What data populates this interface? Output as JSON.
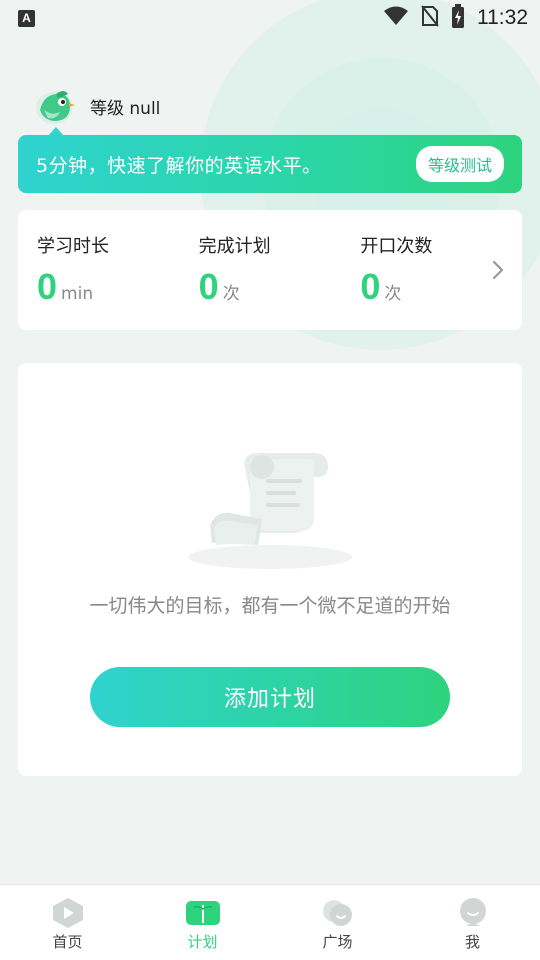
{
  "status_bar": {
    "left_icon": "A",
    "time": "11:32",
    "icons": [
      "wifi-icon",
      "no-sim-icon",
      "battery-charging-icon"
    ]
  },
  "profile": {
    "level_label": "等级 null"
  },
  "banner": {
    "text": "5分钟，快速了解你的英语水平。",
    "button_label": "等级测试"
  },
  "stats": [
    {
      "label": "学习时长",
      "value": "0",
      "unit": "min"
    },
    {
      "label": "完成计划",
      "value": "0",
      "unit": "次"
    },
    {
      "label": "开口次数",
      "value": "0",
      "unit": "次"
    }
  ],
  "plan": {
    "empty_text": "一切伟大的目标，都有一个微不足道的开始",
    "add_button_label": "添加计划"
  },
  "tabs": [
    {
      "label": "首页",
      "icon": "play-hexagon-icon",
      "active": false
    },
    {
      "label": "计划",
      "icon": "book-icon",
      "active": true
    },
    {
      "label": "广场",
      "icon": "chat-bubbles-icon",
      "active": false
    },
    {
      "label": "我",
      "icon": "person-face-icon",
      "active": false
    }
  ],
  "colors": {
    "accent_green": "#2ed37e",
    "accent_cyan": "#2fd3cf",
    "background": "#eff3f2"
  }
}
